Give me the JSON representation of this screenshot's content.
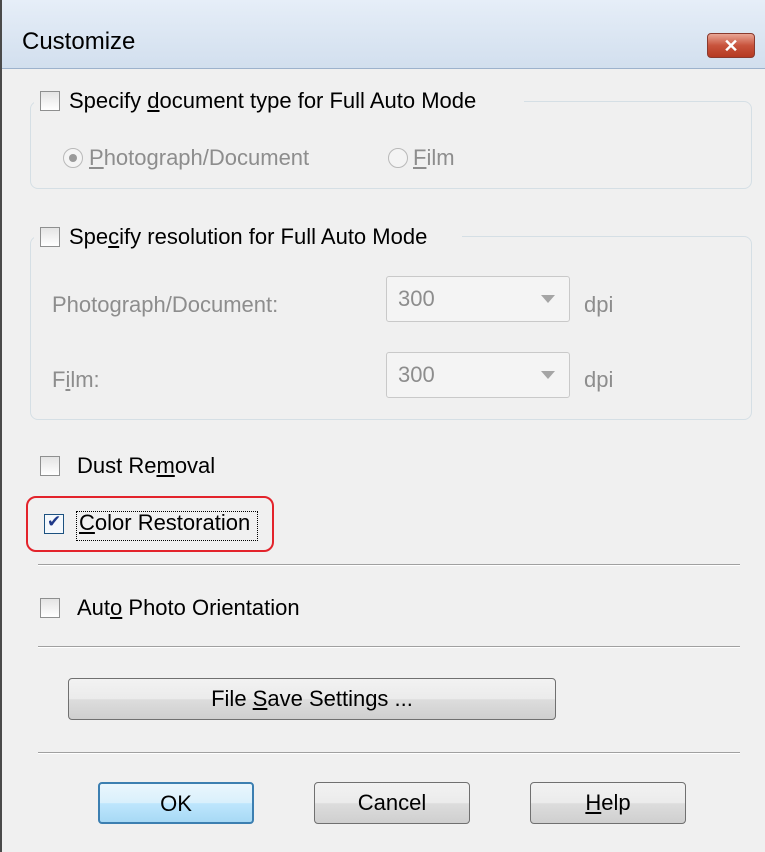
{
  "window": {
    "title": "Customize",
    "close_glyph": "✕"
  },
  "doc_type": {
    "checkbox_label": "Specify document type for Full Auto Mode",
    "checked": false,
    "options": [
      {
        "label": "Photograph/Document",
        "selected": true
      },
      {
        "label": "Film",
        "selected": false
      }
    ]
  },
  "resolution": {
    "checkbox_label": "Specify resolution for Full Auto Mode",
    "checked": false,
    "photo_label": "Photograph/Document:",
    "photo_value": "300",
    "film_label": "Film:",
    "film_value": "300",
    "unit": "dpi"
  },
  "dust_removal": {
    "label": "Dust Removal",
    "checked": false
  },
  "color_restoration": {
    "label": "Color Restoration",
    "checked": true
  },
  "auto_orientation": {
    "label": "Auto Photo Orientation",
    "checked": false
  },
  "buttons": {
    "file_save": "File Save Settings ...",
    "ok": "OK",
    "cancel": "Cancel",
    "help": "Help"
  },
  "colors": {
    "highlight": "#e3232b",
    "title_bar": "#d2dfee",
    "close_button": "#c8533c"
  },
  "icons": {
    "close": "close-icon",
    "dropdown": "chevron-down-icon",
    "check": "check-icon"
  }
}
